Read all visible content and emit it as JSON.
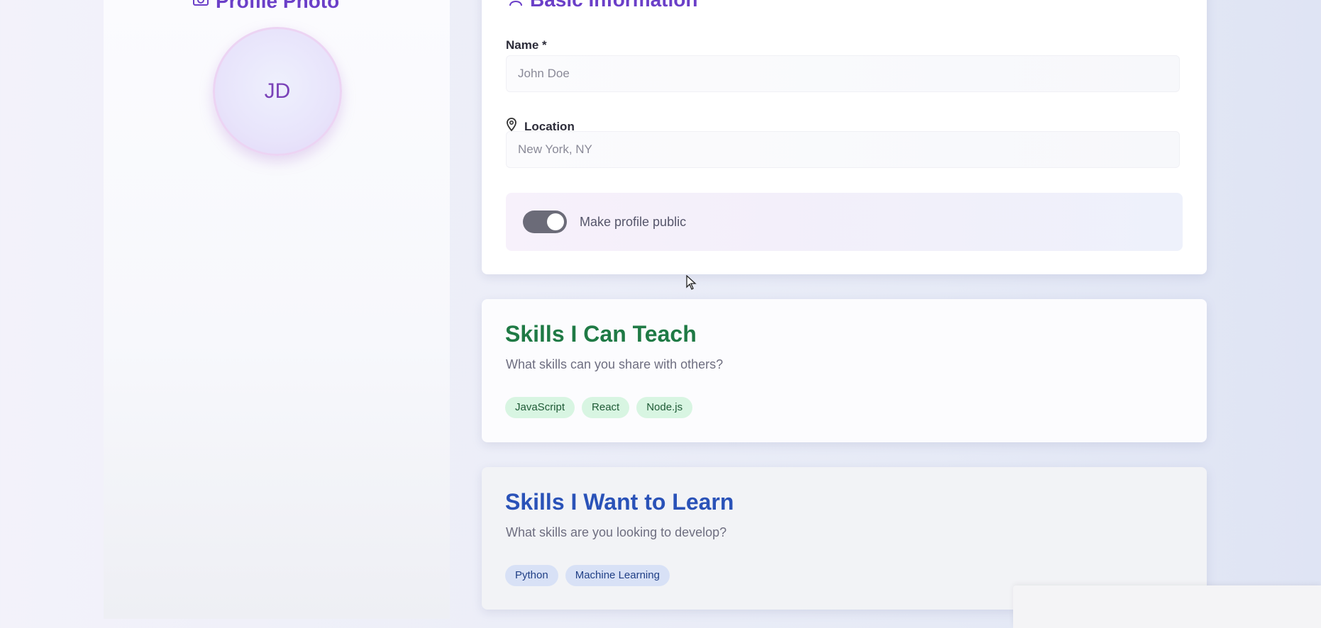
{
  "profile_photo": {
    "title": "Profile Photo",
    "icon": "camera-icon",
    "initials": "JD"
  },
  "basic_info": {
    "title": "Basic Information",
    "icon": "user-icon",
    "name_label": "Name *",
    "name_placeholder": "John Doe",
    "location_label": "Location",
    "location_icon": "map-pin-icon",
    "location_placeholder": "New York, NY",
    "public_toggle_label": "Make profile public",
    "public_toggle_on": true
  },
  "skills_teach": {
    "title": "Skills I Can Teach",
    "subtitle": "What skills can you share with others?",
    "tags": [
      "JavaScript",
      "React",
      "Node.js"
    ]
  },
  "skills_learn": {
    "title": "Skills I Want to Learn",
    "subtitle": "What skills are you looking to develop?",
    "tags": [
      "Python",
      "Machine Learning"
    ]
  },
  "colors": {
    "accent_purple": "#6b3fc8",
    "teach_green": "#1f7a45",
    "learn_blue": "#2a52b8"
  }
}
